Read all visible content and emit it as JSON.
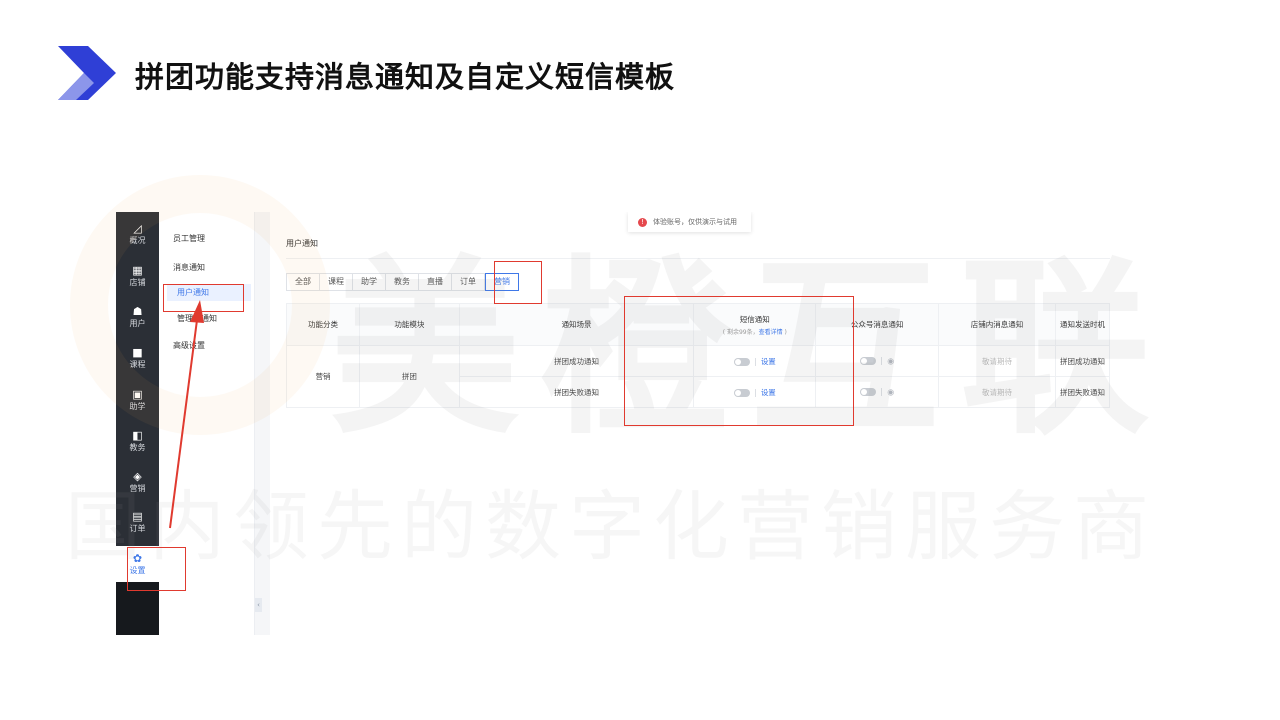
{
  "slide": {
    "title": "拼团功能支持消息通知及自定义短信模板"
  },
  "watermark": {
    "brand": "美橙互联",
    "slogan": "国内领先的数字化营销服务商"
  },
  "side_nav": {
    "items": [
      {
        "icon": "chart-icon",
        "glyph": "◿",
        "label": "概况"
      },
      {
        "icon": "store-icon",
        "glyph": "▦",
        "label": "店铺"
      },
      {
        "icon": "user-icon",
        "glyph": "☗",
        "label": "用户"
      },
      {
        "icon": "course-icon",
        "glyph": "■",
        "label": "课程"
      },
      {
        "icon": "study-icon",
        "glyph": "▣",
        "label": "助学"
      },
      {
        "icon": "edu-icon",
        "glyph": "◧",
        "label": "教务"
      },
      {
        "icon": "tag-icon",
        "glyph": "◈",
        "label": "营销"
      },
      {
        "icon": "order-icon",
        "glyph": "▤",
        "label": "订单"
      },
      {
        "icon": "gear-icon",
        "glyph": "✿",
        "label": "设置"
      }
    ]
  },
  "sub_nav": {
    "items": [
      "员工管理",
      "消息通知",
      "用户通知",
      "管理员通知",
      "高级设置"
    ]
  },
  "notice": {
    "icon": "info-icon",
    "text": "体验账号，仅供演示与试用"
  },
  "content": {
    "page_title": "用户通知",
    "tabs": [
      "全部",
      "课程",
      "助学",
      "教务",
      "直播",
      "订单",
      "营销"
    ],
    "active_tab": "营销",
    "table": {
      "headers": {
        "category": "功能分类",
        "module": "功能模块",
        "scene": "通知场景",
        "sms": "短信通知",
        "sms_sub_prefix": "( 剩余99条，",
        "sms_sub_link": "查看详情",
        "sms_sub_suffix": " )",
        "official": "公众号消息通知",
        "store": "店铺内消息通知",
        "timing": "通知发送时机"
      },
      "category": "营销",
      "module": "拼团",
      "rows": [
        {
          "scene": "拼团成功通知",
          "sms_action": "设置",
          "store": "敬请期待",
          "timing": "拼团成功通知"
        },
        {
          "scene": "拼团失败通知",
          "sms_action": "设置",
          "store": "敬请期待",
          "timing": "拼团失败通知"
        }
      ]
    }
  },
  "colors": {
    "accent": "#3f78e8",
    "annotation": "#e03a2f",
    "nav_bg": "#2b2f36",
    "logo_dark": "#2f3fd6",
    "logo_light": "#8c96ea"
  }
}
